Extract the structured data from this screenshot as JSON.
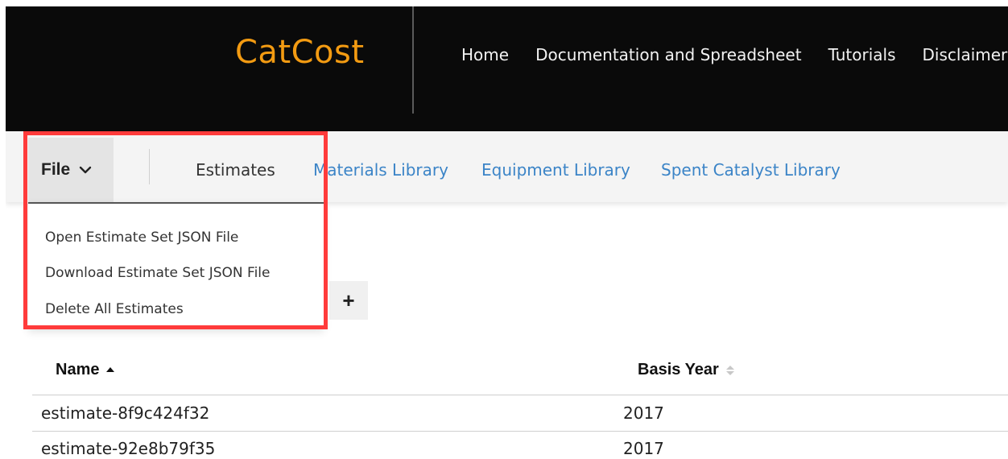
{
  "header": {
    "brand": "CatCost",
    "brand_color": "#f39b12",
    "nav": [
      "Home",
      "Documentation and Spreadsheet",
      "Tutorials",
      "Disclaimer"
    ]
  },
  "tabbar": {
    "file_label": "File",
    "tabs": [
      {
        "label": "Estimates",
        "active": true
      },
      {
        "label": "Materials Library",
        "active": false
      },
      {
        "label": "Equipment Library",
        "active": false
      },
      {
        "label": "Spent Catalyst Library",
        "active": false
      }
    ],
    "link_color": "#3b84c7"
  },
  "file_menu": {
    "items": [
      "Open Estimate Set JSON File",
      "Download Estimate Set JSON File",
      "Delete All Estimates"
    ]
  },
  "add_button": {
    "icon": "plus-icon",
    "glyph": "+"
  },
  "table": {
    "headers": [
      "Name",
      "Basis Year"
    ],
    "rows": [
      {
        "name": "estimate-8f9c424f32",
        "basis_year": "2017"
      },
      {
        "name": "estimate-92e8b79f35",
        "basis_year": "2017"
      }
    ]
  },
  "highlight_color": "#ff3b3b"
}
